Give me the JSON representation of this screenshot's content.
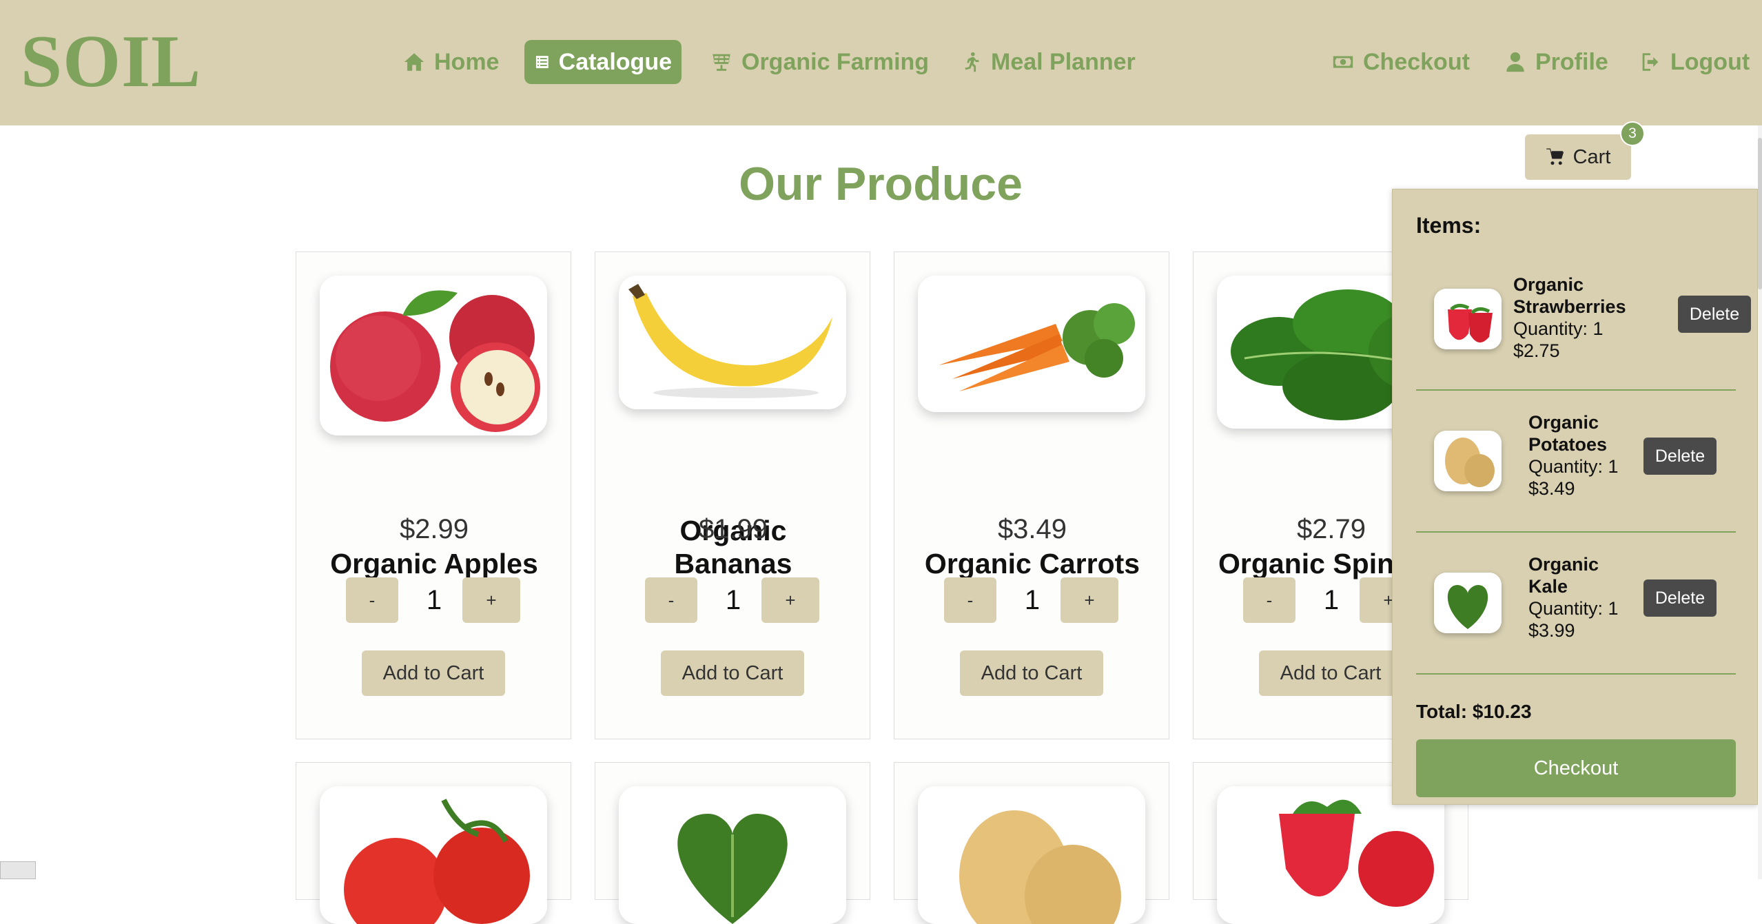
{
  "brand": {
    "logo": "SOIL"
  },
  "nav": {
    "home": "Home",
    "catalogue": "Catalogue",
    "organic_farming": "Organic Farming",
    "meal_planner": "Meal Planner",
    "checkout": "Checkout",
    "profile": "Profile",
    "logout": "Logout",
    "active": "Catalogue"
  },
  "cart_button": {
    "label": "Cart",
    "count": "3"
  },
  "page": {
    "heading": "Our Produce"
  },
  "products": [
    {
      "name": "Organic Apples",
      "price": "$2.99",
      "quantity": "1",
      "minus": "-",
      "plus": "+",
      "add": "Add to Cart"
    },
    {
      "name": "Organic Bananas",
      "price": "$1.99",
      "quantity": "1",
      "minus": "-",
      "plus": "+",
      "add": "Add to Cart"
    },
    {
      "name": "Organic Carrots",
      "price": "$3.49",
      "quantity": "1",
      "minus": "-",
      "plus": "+",
      "add": "Add to Cart"
    },
    {
      "name": "Organic Spin",
      "price": "$2.79",
      "quantity": "1",
      "minus": "-",
      "plus": "+",
      "add": "Add to Cart"
    }
  ],
  "cart": {
    "title": "Items:",
    "items": [
      {
        "name_line1": "Organic",
        "name_line2": "Strawberries",
        "quantity": "Quantity: 1",
        "price": "$2.75",
        "delete": "Delete"
      },
      {
        "name_line1": "Organic",
        "name_line2": "Potatoes",
        "quantity": "Quantity: 1",
        "price": "$3.49",
        "delete": "Delete"
      },
      {
        "name_line1": "Organic",
        "name_line2": "Kale",
        "quantity": "Quantity: 1",
        "price": "$3.99",
        "delete": "Delete"
      }
    ],
    "total": "Total: $10.23",
    "checkout": "Checkout"
  },
  "colors": {
    "header_bg": "#d9d0b1",
    "accent_green": "#7fa35c",
    "delete_button": "#4a4a4a"
  },
  "icons": {
    "home": "home-icon",
    "catalogue": "list-icon",
    "organic_farming": "solar-panel-icon",
    "meal_planner": "running-person-icon",
    "checkout": "money-bill-icon",
    "profile": "user-icon",
    "logout": "sign-out-icon",
    "cart": "shopping-cart-icon"
  }
}
